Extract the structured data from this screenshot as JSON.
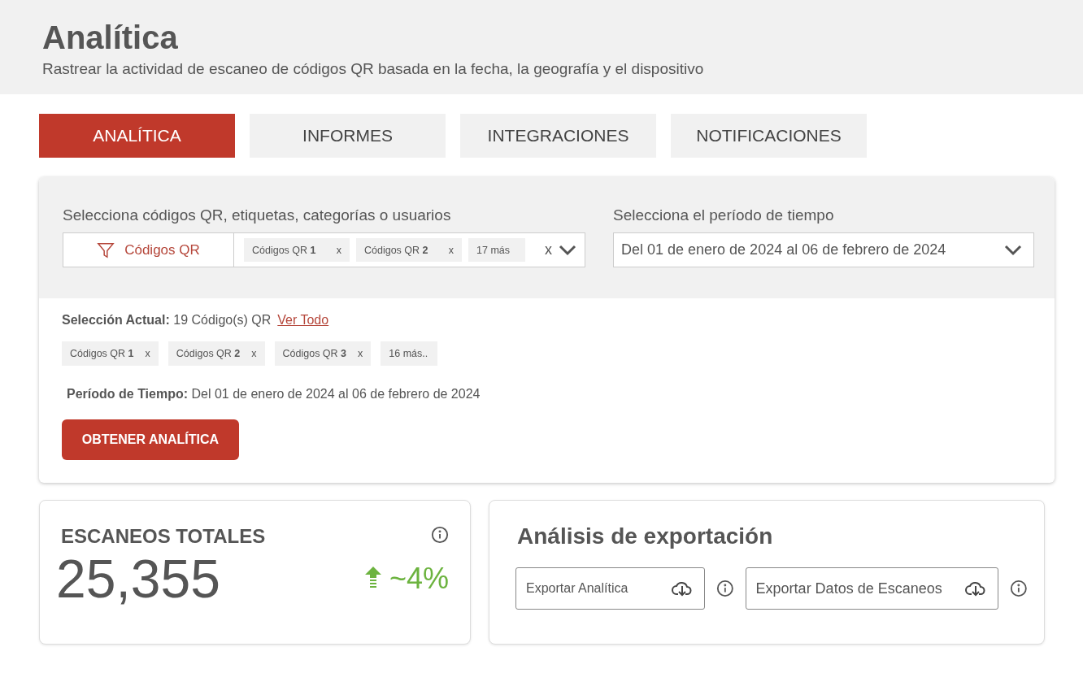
{
  "header": {
    "title": "Analítica",
    "subtitle": "Rastrear la actividad de escaneo de códigos QR basada en la fecha, la geografía y el dispositivo"
  },
  "tabs": [
    {
      "label": "ANALÍTICA",
      "selected": true
    },
    {
      "label": "INFORMES",
      "selected": false
    },
    {
      "label": "INTEGRACIONES",
      "selected": false
    },
    {
      "label": "NOTIFICACIONES",
      "selected": false
    }
  ],
  "filters": {
    "selector_label": "Selecciona códigos QR, etiquetas, categorías o usuarios",
    "filter_button": "Códigos QR",
    "chips": [
      {
        "label": "Códigos QR **1**",
        "remove": "x"
      },
      {
        "label": "Códigos QR **2**",
        "remove": "x"
      },
      {
        "label": "17 más"
      }
    ],
    "clear": "x",
    "period_label": "Selecciona el período de tiempo",
    "period_value": "Del 01 de enero de 2024 al 06 de febrero de 2024"
  },
  "selection": {
    "label": "Selección Actual:",
    "value": "19 Código(s) QR",
    "link": "Ver Todo",
    "chips": [
      {
        "label": "Códigos QR **1**",
        "remove": "x"
      },
      {
        "label": "Códigos QR **2**",
        "remove": "x"
      },
      {
        "label": "Códigos QR **3**",
        "remove": "x"
      },
      {
        "label": "16 más.."
      }
    ],
    "period_label": "Período de Tiempo:",
    "period_value": "Del 01 de enero de 2024 al 06 de febrero de 2024",
    "button": "OBTENER ANALÍTICA"
  },
  "total_scans": {
    "title": "ESCANEOS TOTALES",
    "value": "25,355",
    "trend": {
      "rising": true,
      "text": "~4%"
    }
  },
  "export": {
    "title": "Análisis de exportación",
    "buttons": [
      {
        "label": "Exportar Analítica"
      },
      {
        "label": "Exportar Datos de Escaneos"
      }
    ]
  }
}
